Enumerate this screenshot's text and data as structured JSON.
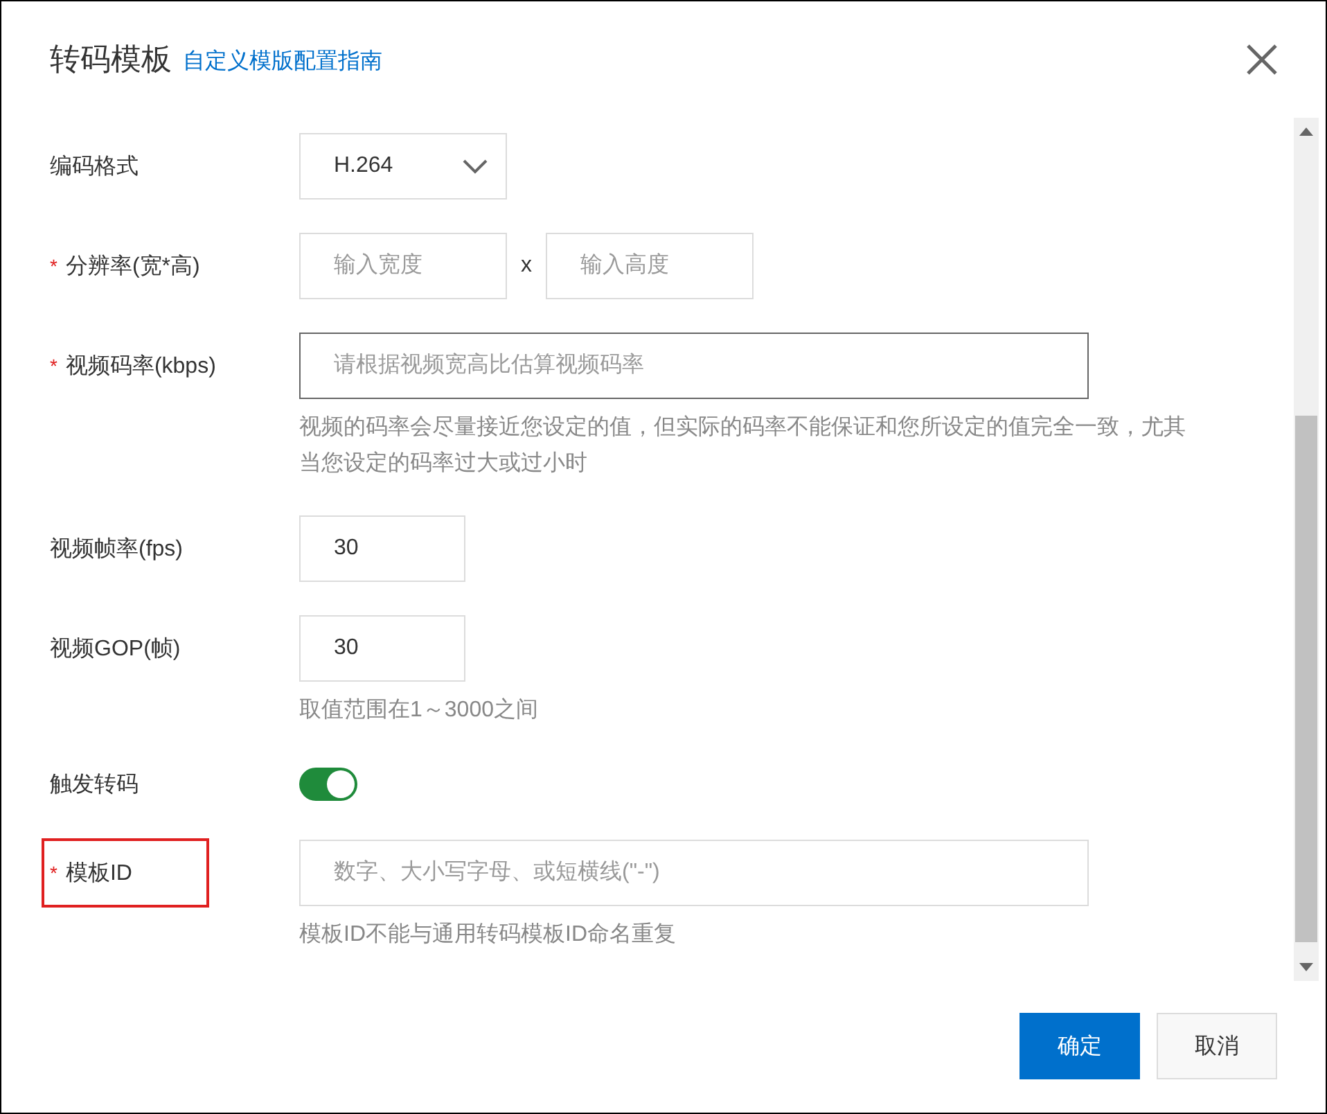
{
  "dialog": {
    "title": "转码模板",
    "guide_link": "自定义模版配置指南"
  },
  "fields": [
    {
      "kind": "select",
      "label": "编码格式",
      "value": "H.264"
    },
    {
      "kind": "resolution",
      "label": "分辨率(宽*高)",
      "required_mark": "*",
      "width_placeholder": "输入宽度",
      "separator": "x",
      "height_placeholder": "输入高度"
    },
    {
      "kind": "text",
      "label": "视频码率(kbps)",
      "required_mark": "*",
      "placeholder": "请根据视频宽高比估算视频码率",
      "focused": true,
      "help": "视频的码率会尽量接近您设定的值，但实际的码率不能保证和您所设定的值完全一致，尤其当您设定的码率过大或过小时"
    },
    {
      "kind": "number",
      "label": "视频帧率(fps)",
      "value": "30"
    },
    {
      "kind": "number",
      "label": "视频GOP(帧)",
      "value": "30",
      "help": "取值范围在1～3000之间"
    },
    {
      "kind": "switch",
      "label": "触发转码",
      "on": true
    },
    {
      "kind": "text",
      "label": "模板ID",
      "required_mark": "*",
      "placeholder": "数字、大小写字母、或短横线(\"-\")",
      "highlighted": true,
      "help": "模板ID不能与通用转码模板ID命名重复"
    }
  ],
  "buttons": [
    {
      "label": "确定",
      "kind": "primary"
    },
    {
      "label": "取消",
      "kind": "secondary"
    }
  ]
}
